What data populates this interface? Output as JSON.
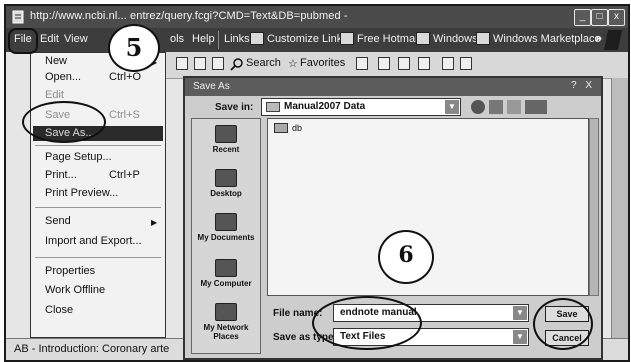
{
  "browser": {
    "title": "http://www.ncbi.nl... entrez/query.fcgi?CMD=Text&DB=pubmed -",
    "window_controls": [
      "_",
      "□",
      "x"
    ],
    "menu": [
      "File",
      "Edit",
      "View",
      "ols",
      "Help"
    ],
    "links_label": "Links",
    "links": [
      "Customize Links",
      "Free Hotmail",
      "Windows",
      "Windows Marketplace"
    ],
    "toolbar": {
      "search": "Search",
      "favorites": "Favorites"
    },
    "status_text": "AB - Introduction: Coronary arte"
  },
  "file_menu": {
    "items": [
      {
        "label": "New",
        "shortcut": "",
        "disabled": false
      },
      {
        "label": "Open...",
        "shortcut": "Ctrl+O",
        "disabled": false
      },
      {
        "label": "Edit",
        "shortcut": "",
        "disabled": true
      },
      {
        "label": "Save",
        "shortcut": "Ctrl+S",
        "disabled": true
      },
      {
        "label": "Save As...",
        "shortcut": "",
        "disabled": false
      },
      {
        "label": "Page Setup...",
        "shortcut": "",
        "disabled": false
      },
      {
        "label": "Print...",
        "shortcut": "Ctrl+P",
        "disabled": false
      },
      {
        "label": "Print Preview...",
        "shortcut": "",
        "disabled": false
      },
      {
        "label": "Send",
        "shortcut": "",
        "disabled": false
      },
      {
        "label": "Import and Export...",
        "shortcut": "",
        "disabled": false
      },
      {
        "label": "Properties",
        "shortcut": "",
        "disabled": false
      },
      {
        "label": "Work Offline",
        "shortcut": "",
        "disabled": false
      },
      {
        "label": "Close",
        "shortcut": "",
        "disabled": false
      }
    ]
  },
  "dialog": {
    "title": "Save As",
    "title_controls": "? X",
    "save_in_label": "Save in:",
    "save_in_value": "Manual2007 Data",
    "file_list": [
      "db"
    ],
    "places": [
      "Recent",
      "Desktop",
      "My Documents",
      "My Computer",
      "My Network Places"
    ],
    "file_name_label": "File name:",
    "file_name_value": "endnote manual",
    "save_type_label": "Save as type:",
    "save_type_value": "Text Files",
    "save_button": "Save",
    "cancel_button": "Cancel"
  },
  "annotations": {
    "step_5": "5",
    "step_6": "6"
  },
  "colors": {
    "title_bar": "#4b4b4b",
    "menu_bar": "#3d3d3d",
    "highlight": "#2a2a2a",
    "dialog_bg": "#cdcdcd"
  }
}
